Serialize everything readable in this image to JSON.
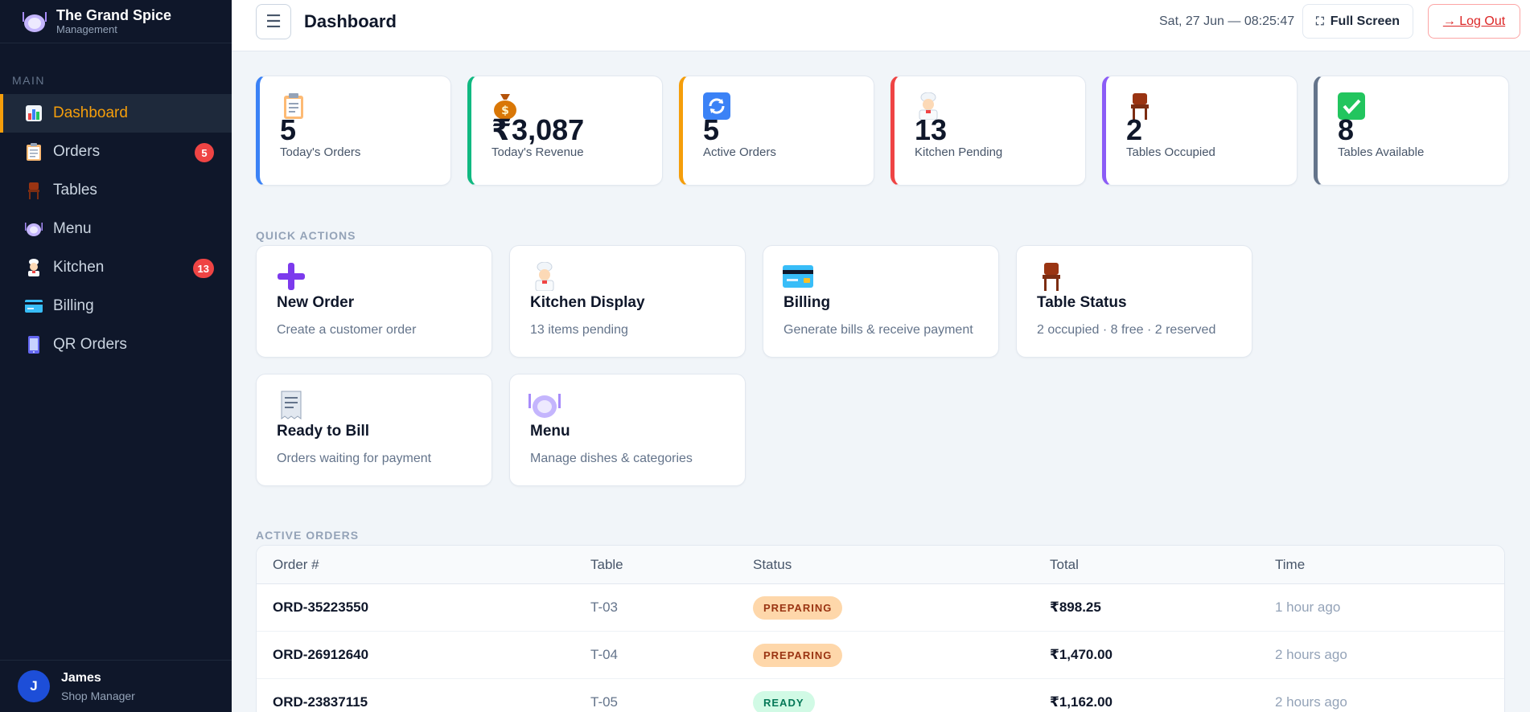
{
  "brand": {
    "name": "The Grand Spice",
    "subtitle": "Management"
  },
  "sidebar": {
    "section": "MAIN",
    "items": [
      {
        "label": "Dashboard",
        "icon": "bar-chart-icon",
        "active": true
      },
      {
        "label": "Orders",
        "icon": "clipboard-icon",
        "badge": "5"
      },
      {
        "label": "Tables",
        "icon": "chair-icon"
      },
      {
        "label": "Menu",
        "icon": "plate-icon"
      },
      {
        "label": "Kitchen",
        "icon": "chef-icon",
        "badge": "13"
      },
      {
        "label": "Billing",
        "icon": "credit-card-icon"
      },
      {
        "label": "QR Orders",
        "icon": "phone-icon"
      }
    ]
  },
  "user": {
    "initial": "J",
    "name": "James",
    "role": "Shop Manager"
  },
  "topbar": {
    "menu_icon": "☰",
    "title": "Dashboard",
    "datetime": "Sat, 27 Jun — 08:25:47",
    "fullscreen_label": "Full Screen",
    "logout_label": "→ Log Out"
  },
  "stats": [
    {
      "value": "5",
      "label": "Today's Orders",
      "icon": "clipboard-icon",
      "color": "#3b82f6"
    },
    {
      "value": "₹3,087",
      "label": "Today's Revenue",
      "icon": "money-bag-icon",
      "color": "#10b981"
    },
    {
      "value": "5",
      "label": "Active Orders",
      "icon": "refresh-icon",
      "color": "#f59e0b"
    },
    {
      "value": "13",
      "label": "Kitchen Pending",
      "icon": "chef-icon",
      "color": "#ef4444"
    },
    {
      "value": "2",
      "label": "Tables Occupied",
      "icon": "chair-icon",
      "color": "#8b5cf6"
    },
    {
      "value": "8",
      "label": "Tables Available",
      "icon": "check-icon",
      "color": "#64748b"
    }
  ],
  "quick_actions_label": "QUICK ACTIONS",
  "quick_actions": [
    {
      "title": "New Order",
      "desc": "Create a customer order",
      "icon": "plus-icon"
    },
    {
      "title": "Kitchen Display",
      "desc": "13 items pending",
      "icon": "chef-icon"
    },
    {
      "title": "Billing",
      "desc": "Generate bills & receive payment",
      "icon": "credit-card-icon"
    },
    {
      "title": "Table Status",
      "desc": "2 occupied · 8 free · 2 reserved",
      "icon": "chair-icon"
    },
    {
      "title": "Ready to Bill",
      "desc": "Orders waiting for payment",
      "icon": "receipt-icon"
    },
    {
      "title": "Menu",
      "desc": "Manage dishes & categories",
      "icon": "plate-icon"
    }
  ],
  "active_orders_label": "ACTIVE ORDERS",
  "orders": {
    "columns": [
      "Order #",
      "Table",
      "Status",
      "Total",
      "Time"
    ],
    "rows": [
      {
        "id": "ORD-35223550",
        "table": "T-03",
        "status": "PREPARING",
        "total": "₹898.25",
        "time": "1 hour ago"
      },
      {
        "id": "ORD-26912640",
        "table": "T-04",
        "status": "PREPARING",
        "total": "₹1,470.00",
        "time": "2 hours ago"
      },
      {
        "id": "ORD-23837115",
        "table": "T-05",
        "status": "READY",
        "total": "₹1,162.00",
        "time": "2 hours ago"
      }
    ]
  }
}
